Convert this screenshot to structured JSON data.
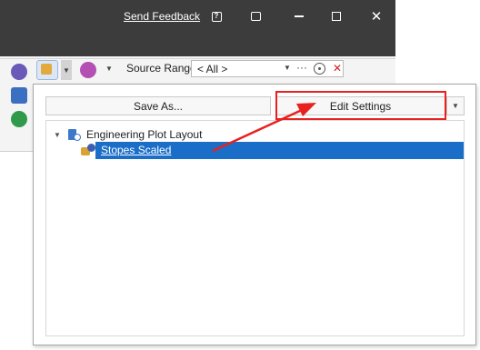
{
  "titlebar": {
    "feedback_link": "Send Feedback",
    "help_icon": "help-icon",
    "restore_icon": "pin-window-icon",
    "minimize_icon": "minimize-icon",
    "maximize_icon": "maximize-icon",
    "close_label": "✕"
  },
  "ribbon": {
    "source_range_label": "Source Range",
    "source_range_value": "< All >",
    "more_label": "···",
    "clear_label": "✕"
  },
  "popup": {
    "save_as_label": "Save As...",
    "edit_settings_label": "Edit Settings",
    "tree": {
      "root_label": "Engineering Plot Layout",
      "child_label": "Stopes Scaled"
    }
  },
  "colors": {
    "titlebar_bg": "#3c3c3c",
    "selection": "#1a6ec8",
    "annotation": "#e8211f"
  }
}
